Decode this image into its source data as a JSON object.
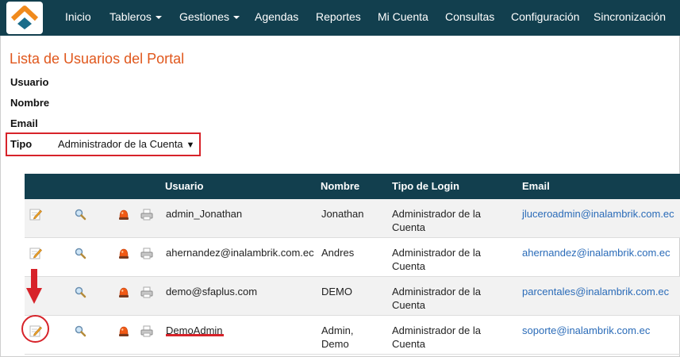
{
  "nav": {
    "items": [
      {
        "label": "Inicio"
      },
      {
        "label": "Tableros"
      },
      {
        "label": "Gestiones"
      },
      {
        "label": "Agendas"
      },
      {
        "label": "Reportes"
      },
      {
        "label": "Mi Cuenta"
      },
      {
        "label": "Consultas"
      },
      {
        "label": "Configuración"
      },
      {
        "label": "Sincronización"
      }
    ]
  },
  "page": {
    "title": "Lista de Usuarios del Portal"
  },
  "filters": {
    "usuario_label": "Usuario",
    "nombre_label": "Nombre",
    "email_label": "Email",
    "tipo_label": "Tipo",
    "tipo_value": "Administrador de la Cuenta"
  },
  "table": {
    "headers": {
      "usuario": "Usuario",
      "nombre": "Nombre",
      "tipo_login": "Tipo de Login",
      "email": "Email"
    },
    "rows": [
      {
        "usuario": "admin_Jonathan",
        "nombre": "Jonathan",
        "tipo": "Administrador de la Cuenta",
        "email": "jluceroadmin@inalambrik.com.ec"
      },
      {
        "usuario": "ahernandez@inalambrik.com.ec",
        "nombre": "Andres",
        "tipo": "Administrador de la Cuenta",
        "email": "ahernandez@inalambrik.com.ec"
      },
      {
        "usuario": "demo@sfaplus.com",
        "nombre": "DEMO",
        "tipo": "Administrador de la Cuenta",
        "email": "parcentales@inalambrik.com.ec"
      },
      {
        "usuario": "DemoAdmin",
        "nombre": "Admin, Demo",
        "tipo": "Administrador de la Cuenta",
        "email": "soporte@inalambrik.com.ec"
      }
    ]
  },
  "colors": {
    "navbar": "#123f4e",
    "title": "#e0571c",
    "highlight": "#d7232a",
    "link": "#2a6bb8"
  },
  "icons": [
    "logo-icon",
    "edit-icon",
    "search-icon",
    "alarm-icon",
    "print-icon",
    "down-arrow-icon"
  ]
}
